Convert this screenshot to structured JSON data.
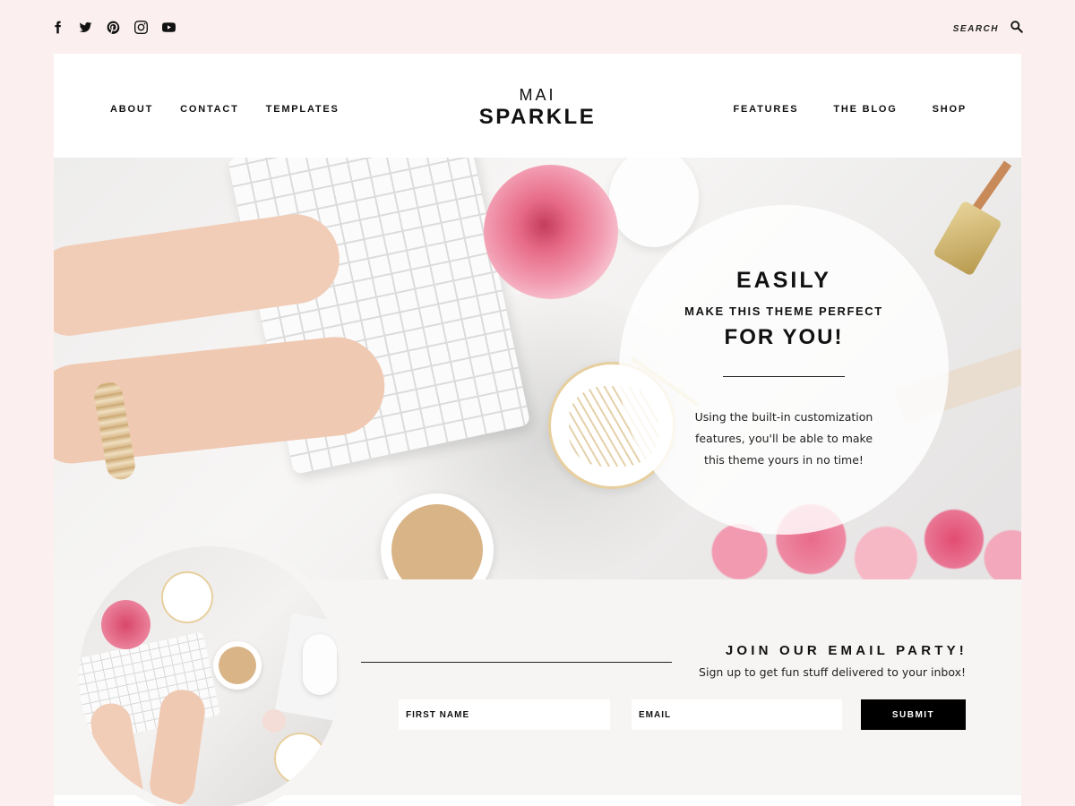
{
  "social": {
    "icons": [
      "facebook-icon",
      "twitter-icon",
      "pinterest-icon",
      "instagram-icon",
      "youtube-icon"
    ]
  },
  "search": {
    "label": "SEARCH",
    "icon": "search-icon"
  },
  "header": {
    "logo_top": "MAI",
    "logo_main": "SPARKLE",
    "nav_left": [
      "ABOUT",
      "CONTACT",
      "TEMPLATES"
    ],
    "nav_right": [
      "FEATURES",
      "THE BLOG",
      "SHOP"
    ]
  },
  "hero": {
    "title1": "EASILY",
    "subtitle": "MAKE THIS THEME PERFECT",
    "title2": "FOR YOU!",
    "text": "Using the built-in customization features, you'll be able to make this theme yours in no time!"
  },
  "email_signup": {
    "title": "JOIN OUR EMAIL PARTY!",
    "subtitle": "Sign up to get fun stuff delivered to your inbox!",
    "first_name_placeholder": "FIRST NAME",
    "email_placeholder": "EMAIL",
    "submit_label": "SUBMIT"
  },
  "colors": {
    "page_bg": "#fbf0ef",
    "accent_black": "#000000",
    "section_bg": "#f7f5f3"
  }
}
